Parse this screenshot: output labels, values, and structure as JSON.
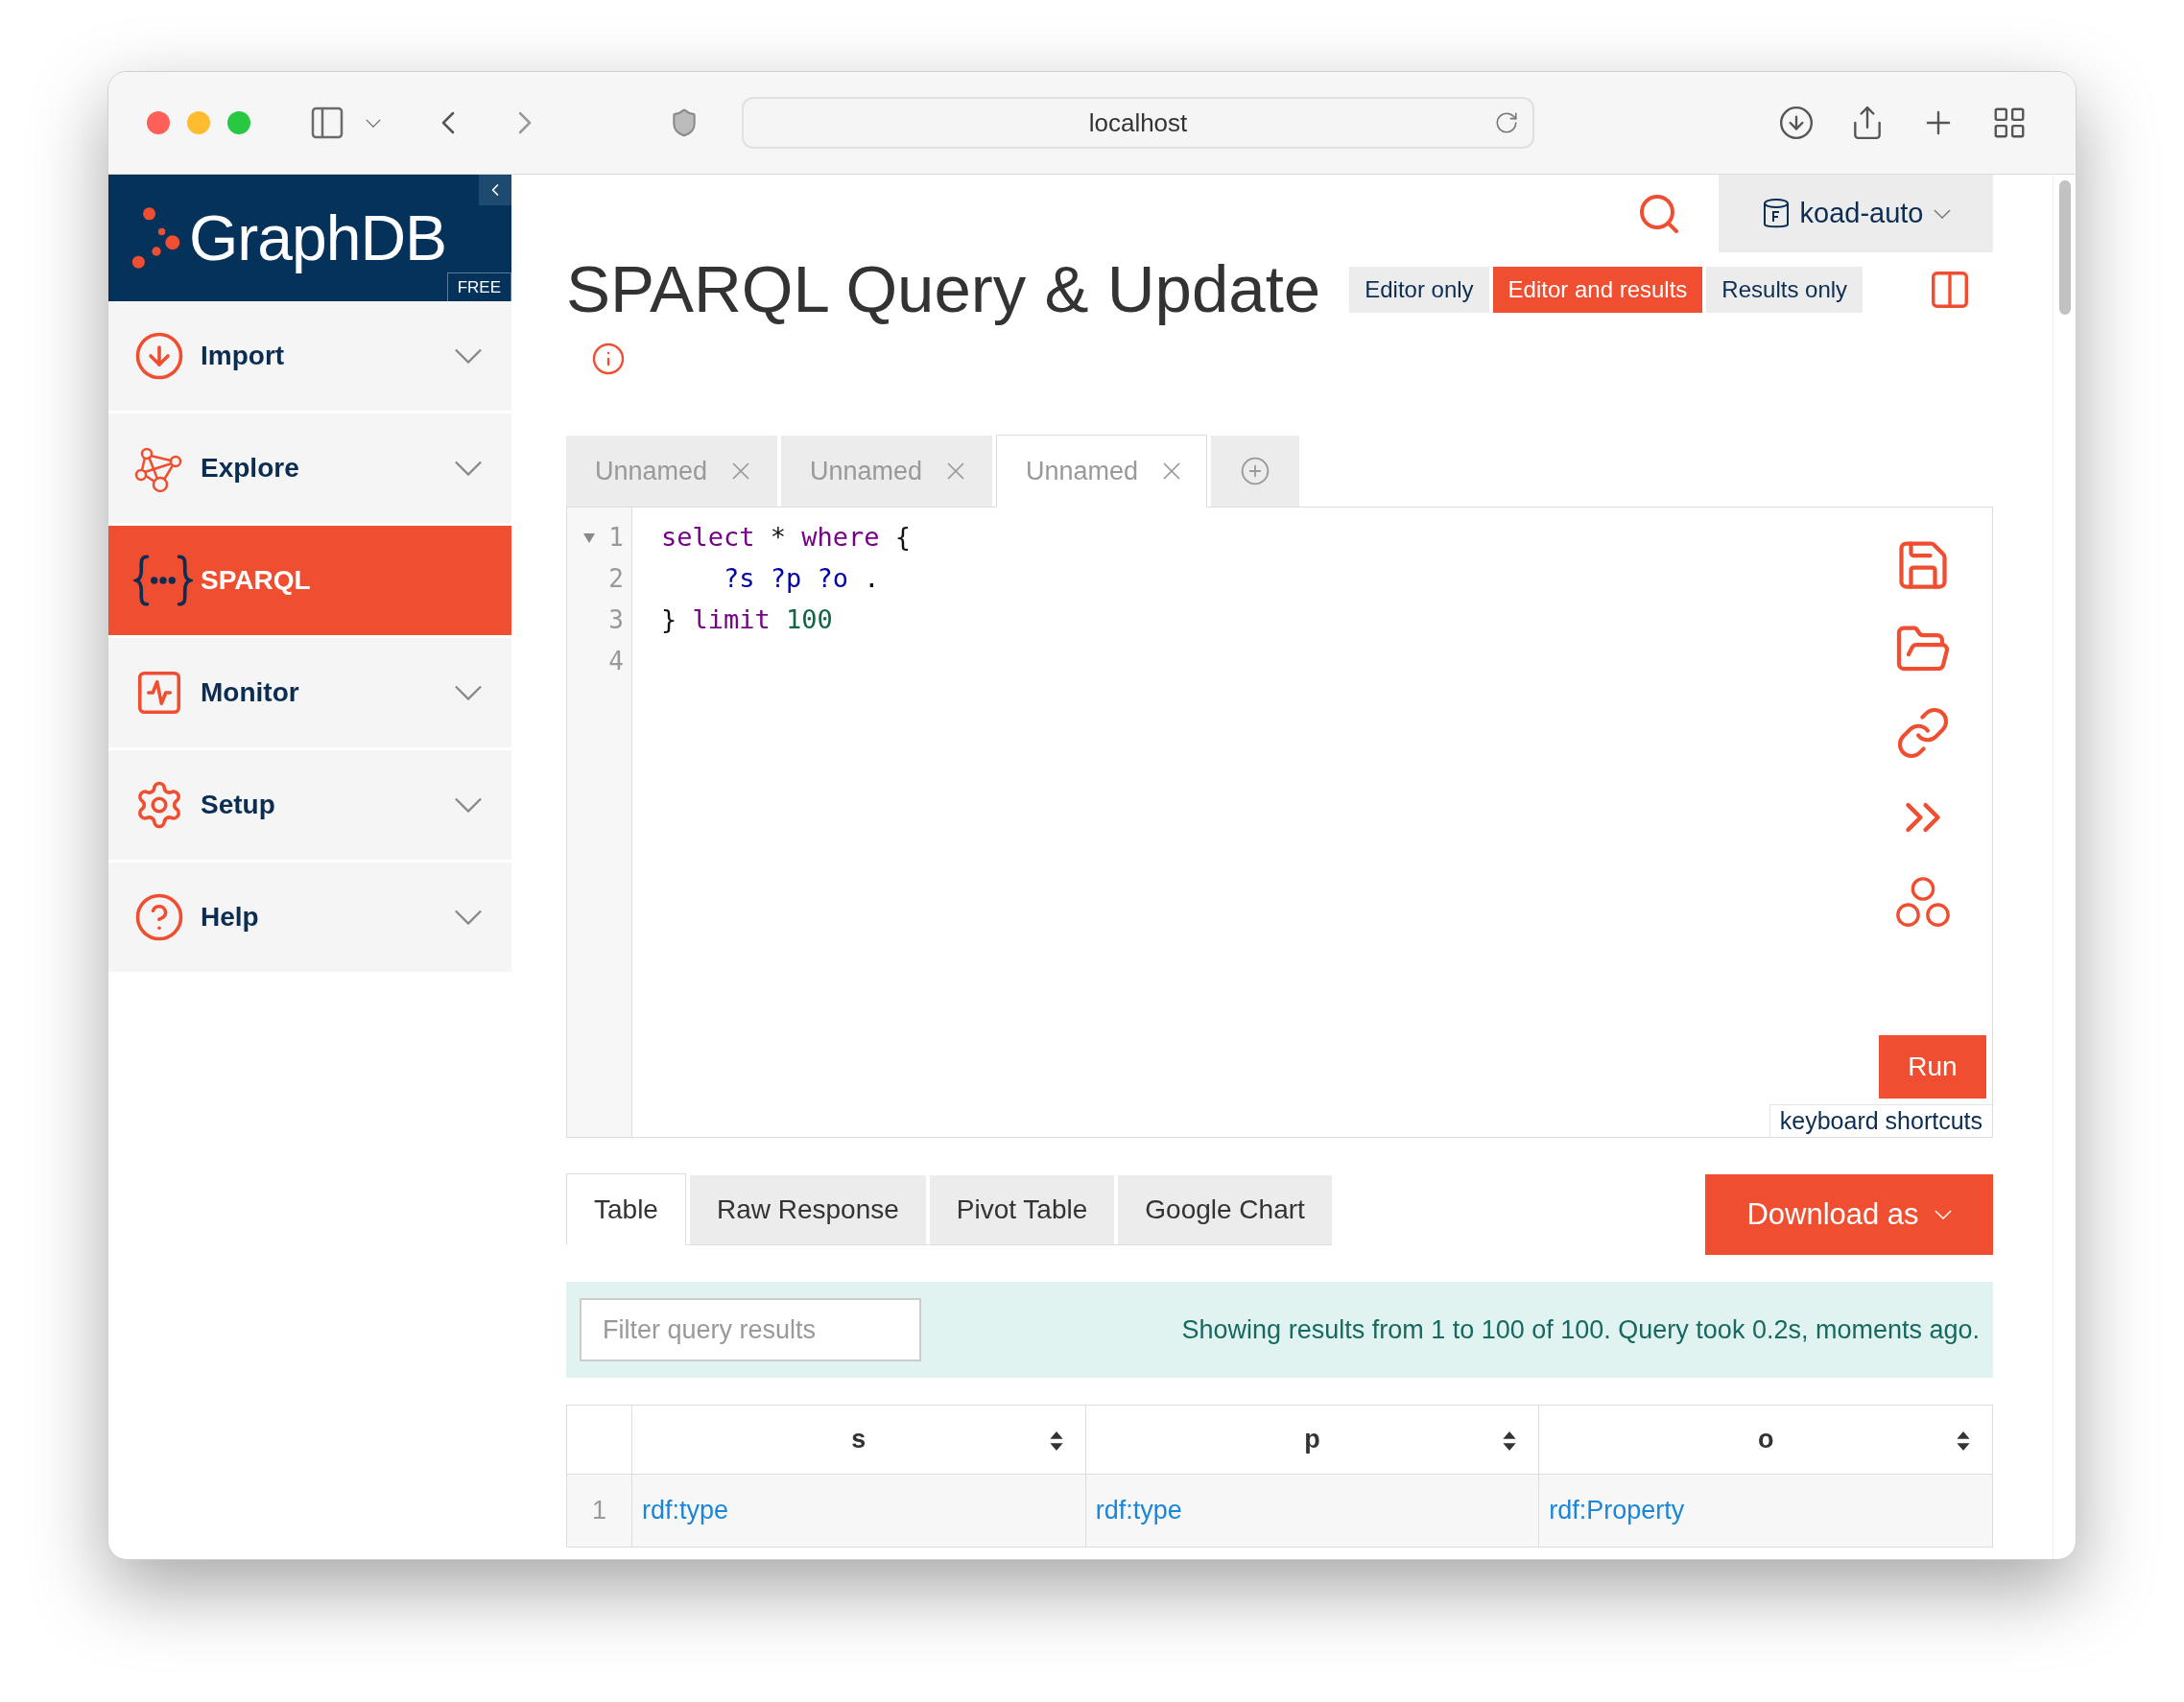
{
  "browser": {
    "url": "localhost"
  },
  "sidebar": {
    "logo": "GraphDB",
    "edition": "FREE",
    "items": [
      {
        "label": "Import",
        "kind": "import",
        "selected": false,
        "expandable": true
      },
      {
        "label": "Explore",
        "kind": "explore",
        "selected": false,
        "expandable": true
      },
      {
        "label": "SPARQL",
        "kind": "sparql",
        "selected": true,
        "expandable": false
      },
      {
        "label": "Monitor",
        "kind": "monitor",
        "selected": false,
        "expandable": true
      },
      {
        "label": "Setup",
        "kind": "setup",
        "selected": false,
        "expandable": true
      },
      {
        "label": "Help",
        "kind": "help",
        "selected": false,
        "expandable": true
      }
    ]
  },
  "header": {
    "repository": "koad-auto"
  },
  "title": "SPARQL Query & Update",
  "view_modes": [
    {
      "label": "Editor only",
      "selected": false
    },
    {
      "label": "Editor and results",
      "selected": true
    },
    {
      "label": "Results only",
      "selected": false
    }
  ],
  "editor_tabs": [
    {
      "label": "Unnamed",
      "selected": false
    },
    {
      "label": "Unnamed",
      "selected": false
    },
    {
      "label": "Unnamed",
      "selected": true
    }
  ],
  "code_lines": [
    {
      "number": "1",
      "foldable": true,
      "tokens": [
        {
          "kind": "keyword",
          "text": "select"
        },
        {
          "kind": "plain",
          "text": " * "
        },
        {
          "kind": "keyword",
          "text": "where"
        },
        {
          "kind": "plain",
          "text": " {"
        }
      ]
    },
    {
      "number": "2",
      "foldable": false,
      "tokens": [
        {
          "kind": "variable",
          "text": "    ?s ?p ?o"
        },
        {
          "kind": "plain",
          "text": " ."
        }
      ]
    },
    {
      "number": "3",
      "foldable": false,
      "tokens": [
        {
          "kind": "plain",
          "text": "} "
        },
        {
          "kind": "keyword",
          "text": "limit "
        },
        {
          "kind": "number",
          "text": "100"
        }
      ]
    },
    {
      "number": "4",
      "foldable": false
    }
  ],
  "run_button": "Run",
  "shortcuts_link": "keyboard shortcuts",
  "result_tabs": [
    {
      "label": "Table",
      "selected": true
    },
    {
      "label": "Raw Response",
      "selected": false
    },
    {
      "label": "Pivot Table",
      "selected": false
    },
    {
      "label": "Google Chart",
      "selected": false
    }
  ],
  "download_button": "Download as",
  "filter": {
    "placeholder": "Filter query results"
  },
  "status": "Showing results from 1 to 100 of 100. Query took 0.2s, moments ago.",
  "table": {
    "columns": [
      "s",
      "p",
      "o"
    ],
    "rows": [
      {
        "number": "1",
        "cells": [
          "rdf:type",
          "rdf:type",
          "rdf:Property"
        ]
      }
    ]
  }
}
